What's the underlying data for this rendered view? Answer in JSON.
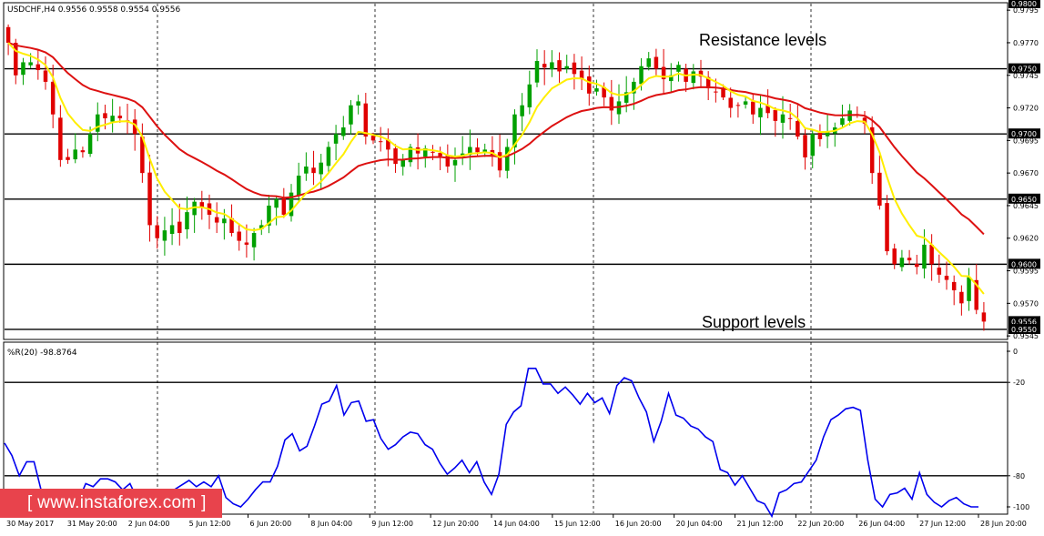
{
  "chart_header": {
    "symbol": "USDCHF,H4",
    "ohlc": "0.9556 0.9558 0.9554 0.9556"
  },
  "annotations": {
    "resistance": "Resistance levels",
    "support": "Support levels"
  },
  "indicator": {
    "label": "%R(20) -98.8764",
    "levels": [
      0,
      -20,
      -80,
      -100
    ],
    "level_tick_labels": [
      "0",
      "-20",
      "-80",
      "-100"
    ]
  },
  "watermark": "www.instaforex.com",
  "colors": {
    "bull": "#00a000",
    "bear": "#e00000",
    "ma_fast": "#ffee00",
    "ma_slow": "#dd1111",
    "wpr": "#0000ee",
    "watermark_bg": "#e8434c"
  },
  "chart_data": {
    "type": "candlestick",
    "price_axis": {
      "ylim": [
        0.9543,
        0.98
      ],
      "ticks": [
        "0.9795",
        "0.9770",
        "0.9745",
        "0.9720",
        "0.9695",
        "0.9670",
        "0.9645",
        "0.9620",
        "0.9595",
        "0.9570",
        "0.9545"
      ],
      "boxed_labels": [
        "0.9800",
        "0.9750",
        "0.9700",
        "0.9650",
        "0.9600",
        "0.9556",
        "0.9550"
      ]
    },
    "horizontal_levels": [
      0.975,
      0.97,
      0.965,
      0.96,
      0.955
    ],
    "time_labels": [
      "30 May 2017",
      "31 May 20:00",
      "2 Jun 04:00",
      "5 Jun 12:00",
      "6 Jun 20:00",
      "8 Jun 04:00",
      "9 Jun 12:00",
      "12 Jun 20:00",
      "14 Jun 04:00",
      "15 Jun 12:00",
      "16 Jun 20:00",
      "20 Jun 04:00",
      "21 Jun 12:00",
      "22 Jun 20:00",
      "26 Jun 04:00",
      "27 Jun 12:00",
      "28 Jun 20:00"
    ],
    "close": [
      0.977,
      0.9745,
      0.9755,
      0.9755,
      0.9749,
      0.974,
      0.9715,
      0.968,
      0.968,
      0.9688,
      0.9686,
      0.97,
      0.9715,
      0.9712,
      0.9714,
      0.9712,
      0.971,
      0.97,
      0.967,
      0.963,
      0.962,
      0.9626,
      0.963,
      0.9624,
      0.964,
      0.9648,
      0.9644,
      0.9638,
      0.9632,
      0.9635,
      0.9624,
      0.9618,
      0.9615,
      0.9624,
      0.963,
      0.9645,
      0.965,
      0.9638,
      0.9655,
      0.9668,
      0.9675,
      0.967,
      0.9678,
      0.969,
      0.97,
      0.9705,
      0.9722,
      0.9725,
      0.9698,
      0.9695,
      0.9694,
      0.9688,
      0.9677,
      0.968,
      0.969,
      0.9685,
      0.9689,
      0.9686,
      0.9683,
      0.9675,
      0.968,
      0.9685,
      0.969,
      0.9686,
      0.9688,
      0.9684,
      0.9672,
      0.969,
      0.9715,
      0.9722,
      0.9738,
      0.9756,
      0.9751,
      0.9755,
      0.9748,
      0.9752,
      0.9746,
      0.9742,
      0.9731,
      0.9735,
      0.9728,
      0.9718,
      0.9725,
      0.9732,
      0.974,
      0.9752,
      0.9758,
      0.975,
      0.9742,
      0.9745,
      0.9753,
      0.974,
      0.9748,
      0.9744,
      0.9735,
      0.9732,
      0.9728,
      0.972,
      0.9722,
      0.9725,
      0.9715,
      0.972,
      0.9716,
      0.971,
      0.9715,
      0.9712,
      0.9698,
      0.9682,
      0.97,
      0.9696,
      0.9702,
      0.9705,
      0.9712,
      0.9718,
      0.9715,
      0.9708,
      0.967,
      0.9645,
      0.961,
      0.96,
      0.9605,
      0.9603,
      0.9598,
      0.9615,
      0.96,
      0.9592,
      0.9588,
      0.958,
      0.957,
      0.959,
      0.9565,
      0.9556
    ],
    "wpr": [
      -59,
      -67,
      -80,
      -71,
      -71,
      -90,
      -98,
      -96,
      -98,
      -98,
      -96,
      -85,
      -87,
      -82,
      -82,
      -84,
      -89,
      -85,
      -95,
      -94,
      -98,
      -96,
      -91,
      -89,
      -86,
      -83,
      -87,
      -84,
      -87,
      -80,
      -94,
      -98,
      -100,
      -95,
      -89,
      -84,
      -84,
      -74,
      -57,
      -53,
      -64,
      -61,
      -48,
      -34,
      -32,
      -22,
      -41,
      -33,
      -32,
      -45,
      -44,
      -56,
      -63,
      -60,
      -55,
      -52,
      -53,
      -60,
      -63,
      -72,
      -79,
      -75,
      -70,
      -78,
      -71,
      -84,
      -92,
      -79,
      -47,
      -39,
      -35,
      -11,
      -11,
      -21,
      -21,
      -27,
      -23,
      -28,
      -34,
      -27,
      -33,
      -30,
      -40,
      -22,
      -17,
      -19,
      -30,
      -39,
      -58,
      -45,
      -27,
      -41,
      -43,
      -48,
      -50,
      -55,
      -58,
      -76,
      -78,
      -86,
      -80,
      -88,
      -96,
      -98,
      -106,
      -91,
      -89,
      -85,
      -84,
      -77,
      -70,
      -55,
      -44,
      -41,
      -37,
      -36,
      -38,
      -70,
      -95,
      -100,
      -92,
      -91,
      -88,
      -95,
      -78,
      -92,
      -97,
      -100,
      -96,
      -94,
      -98,
      -100,
      -100
    ]
  }
}
